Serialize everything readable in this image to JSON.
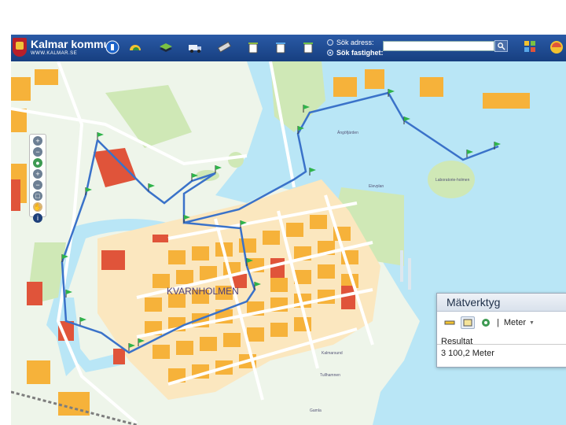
{
  "app": {
    "title": "Kalmar kommun",
    "url": "WWW.KALMAR.SE"
  },
  "toolbar": {
    "tools": [
      {
        "name": "map-layers-icon",
        "color": "#f2c230"
      },
      {
        "name": "layers-stack-icon",
        "color": "#7ac143"
      },
      {
        "name": "truck-icon",
        "color": "#e8eef8"
      },
      {
        "name": "ruler-icon",
        "color": "#d8d8d8"
      },
      {
        "name": "bin-icon",
        "color": "#ffffff"
      },
      {
        "name": "bin-recycle-icon",
        "color": "#58a7e8"
      },
      {
        "name": "bin-green-icon",
        "color": "#6cbf4a"
      }
    ]
  },
  "search": {
    "address_label": "Sök adress:",
    "property_label": "Sök fastighet:",
    "selected": "property",
    "input_value": "",
    "go_icon": "search-icon"
  },
  "map": {
    "labels": {
      "district": "KVARNHOLMEN",
      "l1": "Ängöfjärden",
      "l2": "Laboratorie-holmen",
      "l3": "Kalmarsund",
      "l4": "Tullhamnen",
      "l5": "Elevplan",
      "l6": "Gamla"
    },
    "colors": {
      "water": "#b9e6f6",
      "land": "#eef5ea",
      "park": "#cfe8b6",
      "block": "#fbe7bf",
      "building": "#f6b23a",
      "public": "#e0543a",
      "route": "#3a72c9",
      "flag": "#2fb34a"
    }
  },
  "zoom_tools": [
    "zoom-in-icon",
    "zoom-out-icon",
    "globe-icon",
    "zoom-in-icon",
    "zoom-out-icon",
    "zoom-box-icon",
    "pan-hand-icon",
    "info-icon"
  ],
  "measure": {
    "title": "Mätverktyg",
    "separator": "|",
    "unit": "Meter",
    "result_label": "Resultat",
    "result_value": "3 100,2 Meter"
  }
}
